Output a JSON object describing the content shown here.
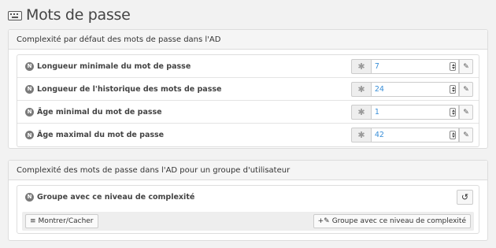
{
  "page": {
    "title": "Mots de passe",
    "icon": "keyboard-icon"
  },
  "default_panel": {
    "heading": "Complexité par défaut des mots de passe dans l'AD",
    "rows": [
      {
        "badge": "N",
        "label": "Longueur minimale du mot de passe",
        "value": "7"
      },
      {
        "badge": "N",
        "label": "Longueur de l'historique des mots de passe",
        "value": "24"
      },
      {
        "badge": "N",
        "label": "Âge minimal du mot de passe",
        "value": "1"
      },
      {
        "badge": "N",
        "label": "Âge maximal du mot de passe",
        "value": "42"
      }
    ],
    "required_symbol": "✱",
    "edit_icon": "edit-icon"
  },
  "group_panel": {
    "heading": "Complexité des mots de passe dans l'AD pour un groupe d'utilisateur",
    "badge": "N",
    "label": "Groupe avec ce niveau de complexité",
    "refresh_icon": "↺",
    "show_hide_label": "Montrer/Cacher",
    "add_label": "Groupe avec ce niveau de complexité",
    "add_prefix": "+✎"
  },
  "colors": {
    "value_text": "#3a8fd8",
    "badge": "#7a7a7a",
    "background": "#f2f2f2"
  }
}
